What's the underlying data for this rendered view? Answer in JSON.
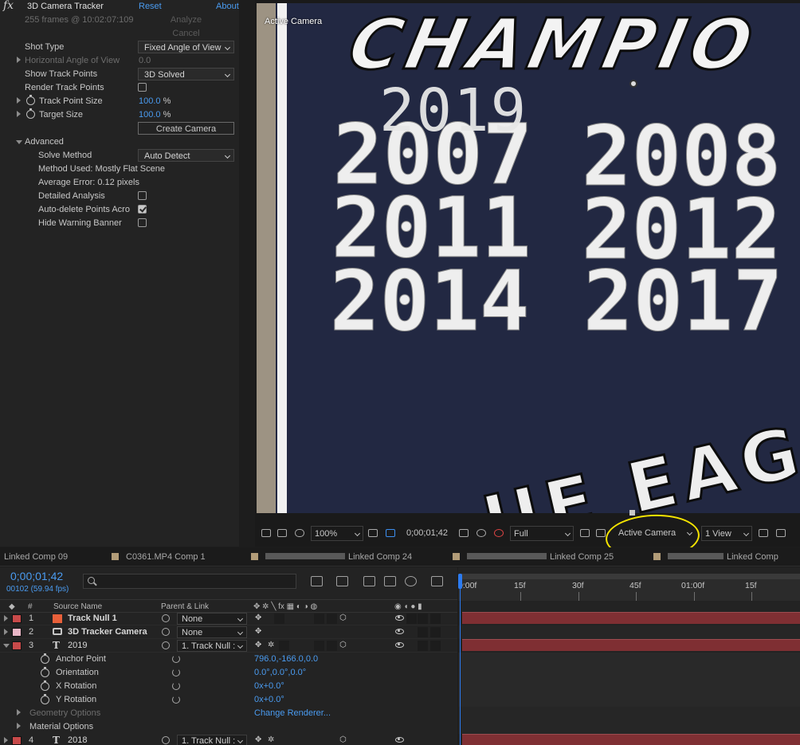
{
  "effects": {
    "fx_glyph": "fx",
    "title": "3D Camera Tracker",
    "reset": "Reset",
    "about": "About",
    "status": "255 frames @ 10:02:07:109",
    "analyze": "Analyze",
    "cancel": "Cancel",
    "shot_type": {
      "label": "Shot Type",
      "value": "Fixed Angle of View"
    },
    "horizontal_angle": {
      "label": "Horizontal Angle of View",
      "value": "0.0"
    },
    "show_track_points": {
      "label": "Show Track Points",
      "value": "3D Solved"
    },
    "render_track_points": {
      "label": "Render Track Points",
      "checked": false
    },
    "track_point_size": {
      "label": "Track Point Size",
      "value": "100.0",
      "unit": "%"
    },
    "target_size": {
      "label": "Target Size",
      "value": "100.0",
      "unit": "%"
    },
    "create_camera": "Create Camera",
    "advanced": "Advanced",
    "solve_method": {
      "label": "Solve Method",
      "value": "Auto Detect"
    },
    "method_used": "Method Used: Mostly Flat Scene",
    "average_error": "Average Error: 0.12 pixels",
    "detailed_analysis": {
      "label": "Detailed Analysis",
      "checked": false
    },
    "auto_delete": {
      "label": "Auto-delete Points Acro",
      "checked": true
    },
    "hide_warning": {
      "label": "Hide Warning Banner",
      "checked": false
    }
  },
  "viewer": {
    "overlay_label": "Active Camera",
    "scene_text": {
      "champ": "CHAMPIO",
      "overlay_year": "2019",
      "years": [
        "2007",
        "2008",
        "2011",
        "2012",
        "2014",
        "2017"
      ],
      "bottom": "UE EAGL"
    },
    "toolbar": {
      "zoom": "100%",
      "timecode": "0;00;01;42",
      "resolution": "Full",
      "camera": "Active Camera",
      "views": "1 View"
    },
    "annotation_color": "#f5e400"
  },
  "tabs": [
    {
      "label": "Linked Comp 09",
      "swatch": false,
      "redacted": false
    },
    {
      "label": "C0361.MP4 Comp 1",
      "swatch": true,
      "redacted": false
    },
    {
      "label": "Linked Comp 24",
      "swatch": true,
      "redacted": true
    },
    {
      "label": "Linked Comp 25",
      "swatch": true,
      "redacted": true
    },
    {
      "label": "Linked Comp",
      "swatch": true,
      "redacted": true
    }
  ],
  "timeline": {
    "timecode": "0;00;01;42",
    "frames": "00102 (59.94 fps)",
    "columns": {
      "num": "#",
      "source": "Source Name",
      "parent": "Parent & Link"
    },
    "layers": [
      {
        "num": "1",
        "name": "Track Null 1",
        "type": "null",
        "label_color": "#c84a4a",
        "swatch_color": "#e8603a",
        "parent": "None"
      },
      {
        "num": "2",
        "name": "3D Tracker Camera",
        "type": "camera",
        "label_color": "#e9b6c6",
        "parent": "None"
      },
      {
        "num": "3",
        "name": "2019",
        "type": "text",
        "label_color": "#c84a4a",
        "parent": "1. Track Null :"
      }
    ],
    "properties": [
      {
        "name": "Anchor Point",
        "value": "796.0,-166.0,0.0"
      },
      {
        "name": "Orientation",
        "value": "0.0°,0.0°,0.0°"
      },
      {
        "name": "X Rotation",
        "value": "0x+0.0°"
      },
      {
        "name": "Y Rotation",
        "value": "0x+0.0°"
      }
    ],
    "geometry_options": "Geometry Options",
    "change_renderer": "Change Renderer...",
    "material_options": "Material Options",
    "layer4": {
      "num": "4",
      "name": "2018",
      "type": "text",
      "label_color": "#c84a4a",
      "parent": "1. Track Null :"
    },
    "ruler_ticks": [
      "0:00f",
      "15f",
      "30f",
      "45f",
      "01:00f",
      "15f"
    ]
  }
}
